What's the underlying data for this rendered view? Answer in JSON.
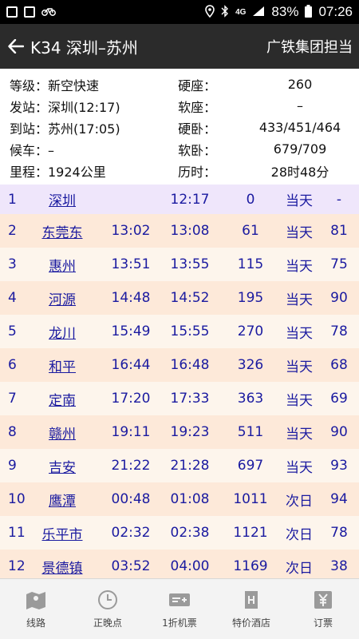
{
  "status_bar": {
    "icons_left": [
      "image-icon",
      "gallery-icon",
      "bike-icon"
    ],
    "network": "4G",
    "battery": "83%",
    "time": "07:26"
  },
  "app_bar": {
    "title": "K34 深圳–苏州",
    "right_text": "广铁集团担当"
  },
  "info": {
    "rows": [
      {
        "left": "等级：新空快速",
        "key": "硬座：",
        "value": "260"
      },
      {
        "left": "发站：深圳(12:17)",
        "key": "软座：",
        "value": "–"
      },
      {
        "left": "到站：苏州(17:05)",
        "key": "硬卧：",
        "value": "433/451/464"
      },
      {
        "left": "候车：–",
        "key": "软卧：",
        "value": "679/709"
      },
      {
        "left": "里程：1924公里",
        "key": "历时：",
        "value": "28时48分"
      }
    ]
  },
  "stops": [
    {
      "no": "1",
      "name": "深圳",
      "arrive": "",
      "depart": "12:17",
      "km": "0",
      "day": "当天",
      "mins": "-"
    },
    {
      "no": "2",
      "name": "东莞东",
      "arrive": "13:02",
      "depart": "13:08",
      "km": "61",
      "day": "当天",
      "mins": "81"
    },
    {
      "no": "3",
      "name": "惠州",
      "arrive": "13:51",
      "depart": "13:55",
      "km": "115",
      "day": "当天",
      "mins": "75"
    },
    {
      "no": "4",
      "name": "河源",
      "arrive": "14:48",
      "depart": "14:52",
      "km": "195",
      "day": "当天",
      "mins": "90"
    },
    {
      "no": "5",
      "name": "龙川",
      "arrive": "15:49",
      "depart": "15:55",
      "km": "270",
      "day": "当天",
      "mins": "78"
    },
    {
      "no": "6",
      "name": "和平",
      "arrive": "16:44",
      "depart": "16:48",
      "km": "326",
      "day": "当天",
      "mins": "68"
    },
    {
      "no": "7",
      "name": "定南",
      "arrive": "17:20",
      "depart": "17:33",
      "km": "363",
      "day": "当天",
      "mins": "69"
    },
    {
      "no": "8",
      "name": "赣州",
      "arrive": "19:11",
      "depart": "19:23",
      "km": "511",
      "day": "当天",
      "mins": "90"
    },
    {
      "no": "9",
      "name": "吉安",
      "arrive": "21:22",
      "depart": "21:28",
      "km": "697",
      "day": "当天",
      "mins": "93"
    },
    {
      "no": "10",
      "name": "鹰潭",
      "arrive": "00:48",
      "depart": "01:08",
      "km": "1011",
      "day": "次日",
      "mins": "94"
    },
    {
      "no": "11",
      "name": "乐平市",
      "arrive": "02:32",
      "depart": "02:38",
      "km": "1121",
      "day": "次日",
      "mins": "78"
    },
    {
      "no": "12",
      "name": "景德镇",
      "arrive": "03:52",
      "depart": "04:00",
      "km": "1169",
      "day": "次日",
      "mins": "38"
    }
  ],
  "bottom_nav": [
    {
      "label": "线路",
      "icon": "map-icon"
    },
    {
      "label": "正晚点",
      "icon": "clock-icon"
    },
    {
      "label": "1折机票",
      "icon": "ticket-icon"
    },
    {
      "label": "特价酒店",
      "icon": "hotel-icon"
    },
    {
      "label": "订票",
      "icon": "yuan-icon"
    }
  ],
  "colors": {
    "app_bar": "#2b2b2b",
    "row_odd": "#fde9d9",
    "row_even": "#fdf5ec",
    "row_first": "#efe6fb",
    "row_text": "#1a1aa0"
  }
}
